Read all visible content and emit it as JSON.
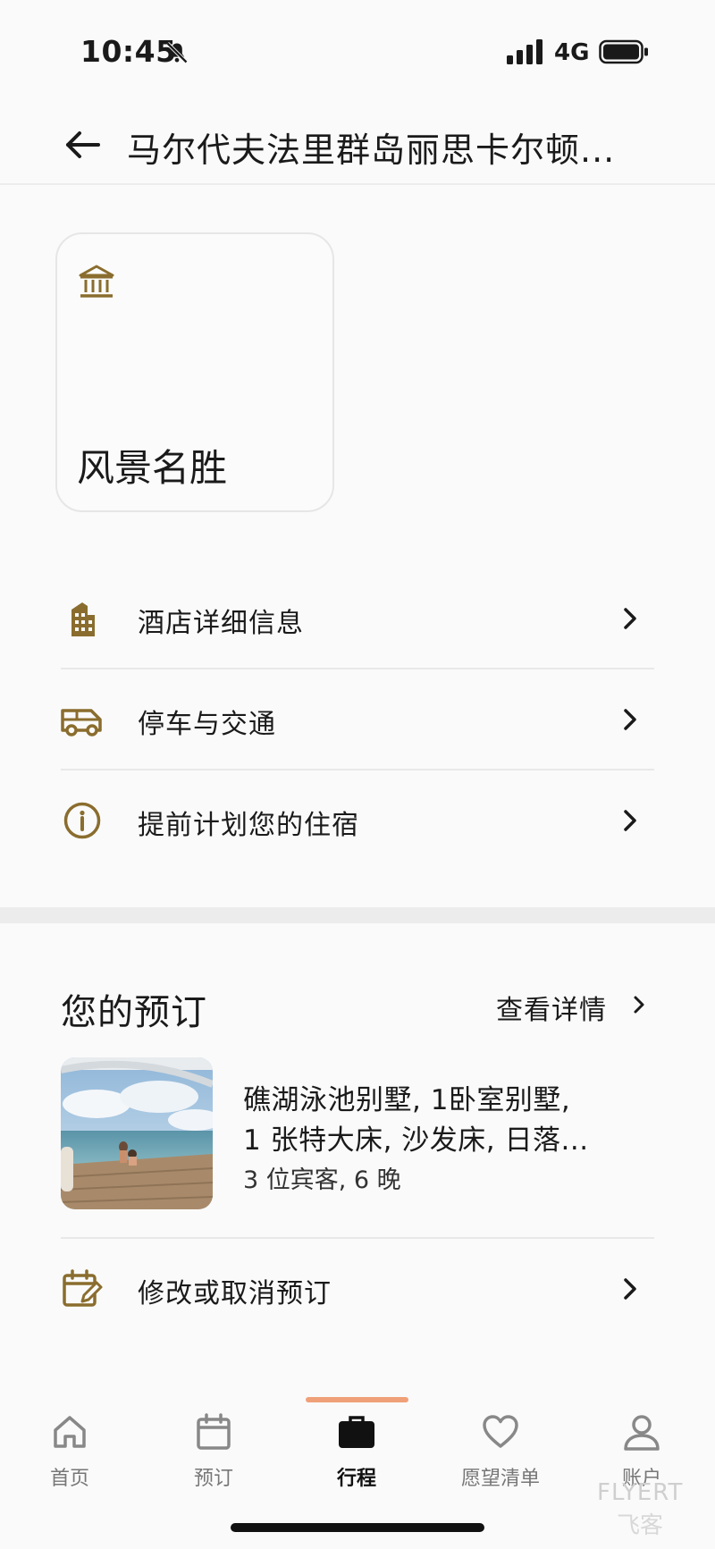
{
  "status_bar": {
    "time": "10:45",
    "network": "4G",
    "icons": [
      "bell-slash-icon",
      "signal-icon",
      "battery-icon"
    ]
  },
  "header": {
    "title": "马尔代夫法里群岛丽思卡尔顿...",
    "back_icon": "arrow-left-icon"
  },
  "tiles": [
    {
      "label": "风景名胜",
      "icon": "landmark-icon"
    }
  ],
  "menu": [
    {
      "label": "酒店详细信息",
      "icon": "building-icon"
    },
    {
      "label": "停车与交通",
      "icon": "van-icon"
    },
    {
      "label": "提前计划您的住宿",
      "icon": "info-icon"
    }
  ],
  "reservation": {
    "section_title": "您的预订",
    "view_details": "查看详情",
    "room_line1": "礁湖泳池别墅, 1卧室别墅,",
    "room_line2": "1 张特大床, 沙发床, 日落...",
    "guests_nights": "3 位宾客, 6 晚",
    "modify_label": "修改或取消预订",
    "modify_icon": "calendar-edit-icon"
  },
  "tab_bar": {
    "active_tab": "行程",
    "tabs": [
      {
        "label": "首页",
        "icon": "home-icon"
      },
      {
        "label": "预订",
        "icon": "calendar-icon"
      },
      {
        "label": "行程",
        "icon": "briefcase-icon"
      },
      {
        "label": "愿望清单",
        "icon": "heart-icon"
      },
      {
        "label": "账户",
        "icon": "user-icon"
      }
    ]
  },
  "watermark": {
    "text": "FLYERT",
    "text_cn": "飞客"
  },
  "colors": {
    "accent": "#8a6d2e",
    "tab_indicator": "#f0a078",
    "background": "#fafafa",
    "divider": "#e8e8e8"
  }
}
